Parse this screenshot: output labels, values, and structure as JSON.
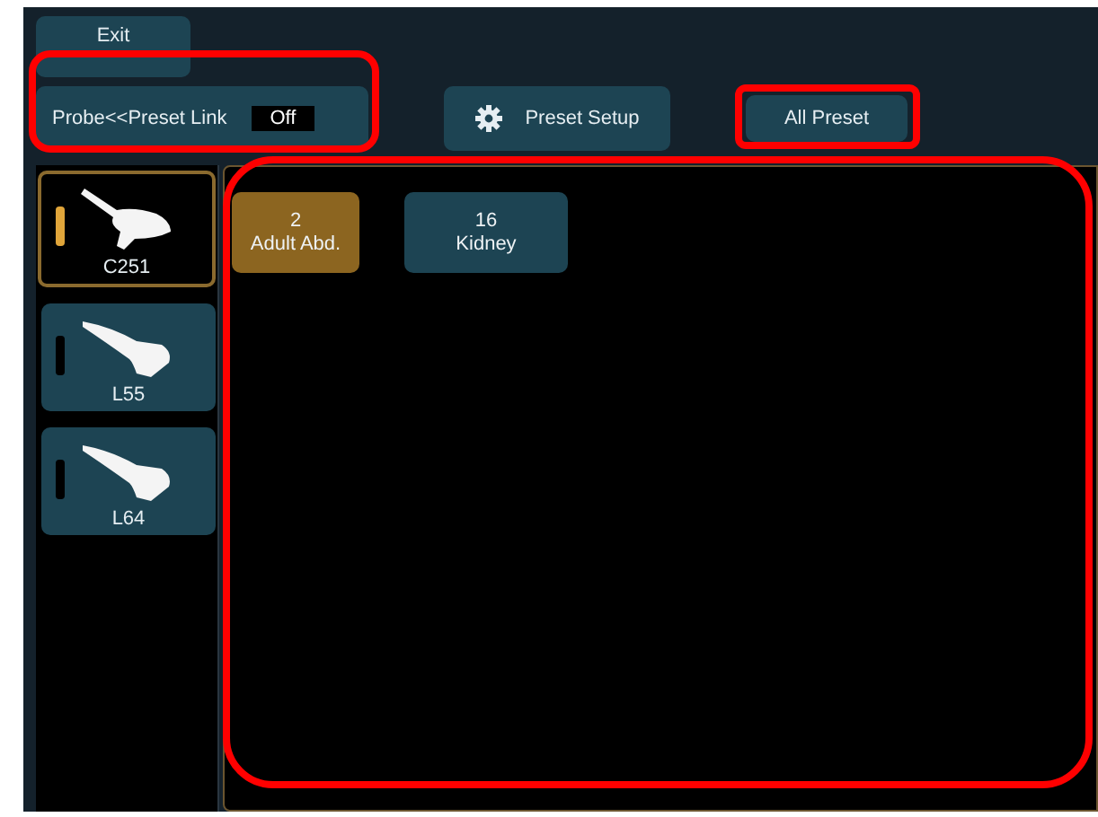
{
  "exit_button": {
    "label": "Exit"
  },
  "link_toggle": {
    "label": "Probe<<Preset Link",
    "value": "Off"
  },
  "preset_setup_button": {
    "label": "Preset Setup"
  },
  "all_preset_button": {
    "label": "All Preset"
  },
  "probes": [
    {
      "name": "C251",
      "kind": "convex",
      "selected": true
    },
    {
      "name": "L55",
      "kind": "linear",
      "selected": false
    },
    {
      "name": "L64",
      "kind": "linear",
      "selected": false
    }
  ],
  "presets": [
    {
      "number": "2",
      "name": "Adult Abd.",
      "selected": true
    },
    {
      "number": "16",
      "name": "Kidney",
      "selected": false
    }
  ]
}
